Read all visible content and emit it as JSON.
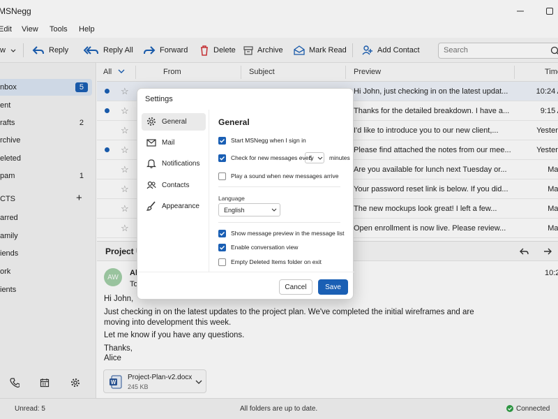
{
  "window": {
    "title": "MSNegg"
  },
  "menu": [
    "Edit",
    "View",
    "Tools",
    "Help"
  ],
  "toolbar": {
    "new_fragment": "w",
    "reply": "Reply",
    "reply_all": "Reply All",
    "forward": "Forward",
    "delete": "Delete",
    "archive": "Archive",
    "mark_read": "Mark Read",
    "add_contact": "Add Contact",
    "search_placeholder": "Search"
  },
  "sidebar": {
    "folders": [
      {
        "label": "nbox",
        "count": "5",
        "active": true
      },
      {
        "label": "ent",
        "count": ""
      },
      {
        "label": "rafts",
        "count": "2"
      },
      {
        "label": "rchive",
        "count": ""
      },
      {
        "label": "eleted",
        "count": ""
      },
      {
        "label": "pam",
        "count": "1"
      }
    ],
    "contacts_header": "CTS",
    "contacts_add": "+",
    "groups": [
      "arred",
      "amily",
      "iends",
      "ork",
      "ients"
    ]
  },
  "list_header": {
    "all": "All",
    "from": "From",
    "subject": "Subject",
    "preview": "Preview",
    "time": "Time"
  },
  "messages": [
    {
      "preview": "Hi John, just checking in on the latest updat...",
      "time": "10:24 A",
      "unread": true
    },
    {
      "preview": "Thanks for the detailed breakdown. I have a...",
      "time": "9:15 A",
      "unread": true
    },
    {
      "preview": "I'd like to introduce you to our new client,...",
      "time": "Yesterd",
      "unread": false
    },
    {
      "preview": "Please find attached the notes from our mee...",
      "time": "Yesterd",
      "unread": true
    },
    {
      "preview": "Are you available for lunch next Tuesday or...",
      "time": "May",
      "unread": false
    },
    {
      "preview": "Your password reset link is below. If you did...",
      "time": "May",
      "unread": false
    },
    {
      "preview": "The new mockups look great! I left a few...",
      "time": "May",
      "unread": false
    },
    {
      "preview": "Open enrollment is now live. Please review...",
      "time": "May",
      "unread": false
    }
  ],
  "reading": {
    "subject": "Project U",
    "avatar_initials": "AW",
    "from": "Al",
    "to": "To",
    "time": "10:2",
    "greeting": "Hi John,",
    "body1": "Just checking in on the latest updates to the project plan. We've completed the initial wireframes and are",
    "body2": "moving into development this week.",
    "body3": "Let me know if you have any questions.",
    "sign1": "Thanks,",
    "sign2": "Alice",
    "attachment_name": "Project-Plan-v2.docx",
    "attachment_size": "245 KB"
  },
  "status": {
    "unread": "Unread: 5",
    "sync": "All folders are up to date.",
    "connection": "Connected"
  },
  "dialog": {
    "title": "Settings",
    "nav": [
      "General",
      "Mail",
      "Notifications",
      "Contacts",
      "Appearance"
    ],
    "heading": "General",
    "opt_start": "Start MSNegg when I sign in",
    "opt_check": "Check for new messages every",
    "check_minutes": "5",
    "minutes_label": "minutes",
    "opt_sound": "Play a sound when new messages arrive",
    "language_label": "Language",
    "language_value": "English",
    "opt_preview": "Show message preview in the message list",
    "opt_conversation": "Enable conversation view",
    "opt_empty": "Empty Deleted Items folder on exit",
    "cancel": "Cancel",
    "save": "Save"
  },
  "colors": {
    "accent": "#1a5fb4",
    "connected": "#2e9e44"
  }
}
